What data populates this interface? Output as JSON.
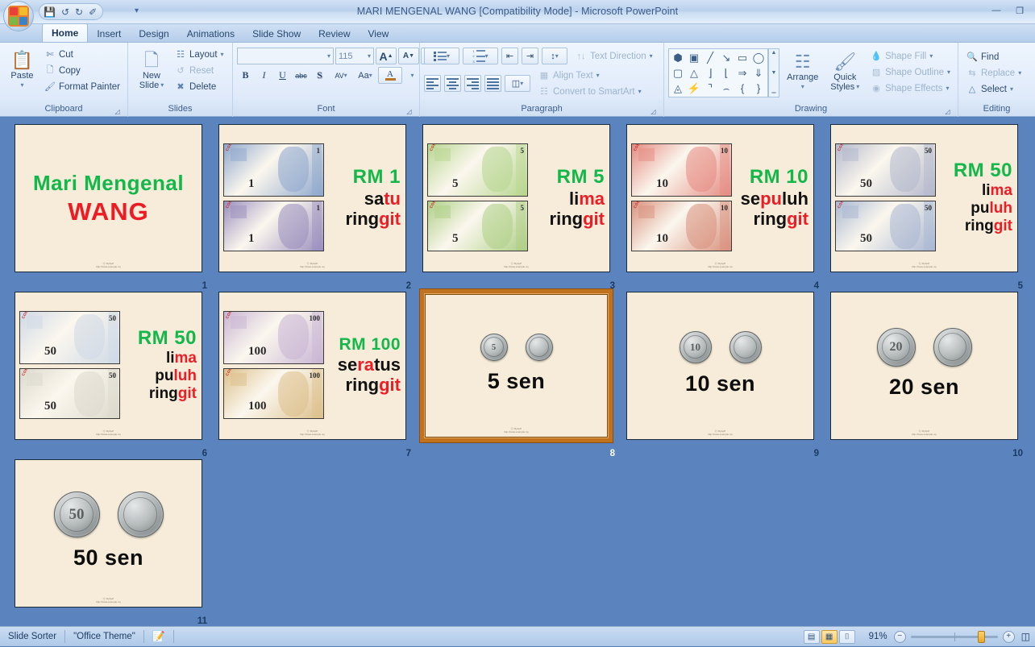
{
  "window": {
    "title": "MARI MENGENAL WANG [Compatibility Mode] - Microsoft PowerPoint",
    "minimize": "—",
    "restore": "❐",
    "qat": {
      "save": "save-icon",
      "undo": "↺",
      "redo": "↻",
      "start": "✐",
      "more": "▾"
    }
  },
  "tabs": [
    {
      "label": "Home",
      "active": true
    },
    {
      "label": "Insert",
      "active": false
    },
    {
      "label": "Design",
      "active": false
    },
    {
      "label": "Animations",
      "active": false
    },
    {
      "label": "Slide Show",
      "active": false
    },
    {
      "label": "Review",
      "active": false
    },
    {
      "label": "View",
      "active": false
    }
  ],
  "ribbon": {
    "clipboard": {
      "label": "Clipboard",
      "paste": "Paste",
      "cut": "Cut",
      "copy": "Copy",
      "format_painter": "Format Painter"
    },
    "slides": {
      "label": "Slides",
      "new_slide_1": "New",
      "new_slide_2": "Slide",
      "layout": "Layout",
      "reset": "Reset",
      "delete": "Delete"
    },
    "font": {
      "label": "Font",
      "font_name": "",
      "font_size": "115",
      "grow": "A",
      "shrink": "A",
      "clear_formatting": "clear-formatting-icon",
      "bold": "B",
      "italic": "I",
      "underline": "U",
      "strikethrough": "abc",
      "shadow": "S",
      "spacing": "AV",
      "change_case": "Aa",
      "font_color": "A"
    },
    "paragraph": {
      "label": "Paragraph",
      "text_direction": "Text Direction",
      "align_text": "Align Text",
      "convert_smartart": "Convert to SmartArt"
    },
    "drawing": {
      "label": "Drawing",
      "arrange": "Arrange",
      "quick_styles_1": "Quick",
      "quick_styles_2": "Styles",
      "shape_fill": "Shape Fill",
      "shape_outline": "Shape Outline",
      "shape_effects": "Shape Effects"
    },
    "editing": {
      "label": "Editing",
      "find": "Find",
      "replace": "Replace",
      "select": "Select"
    }
  },
  "slides": [
    {
      "num": "1",
      "kind": "title",
      "line1": "Mari Mengenal",
      "line2": "WANG",
      "selected": false
    },
    {
      "num": "2",
      "kind": "note",
      "rm": "RM 1",
      "denom": "1",
      "note_front_color": "#8fa8cd",
      "note_back_color": "#9a8fbe",
      "contoh": "CONTOH",
      "words": [
        [
          {
            "t": "sa",
            "c": "black"
          },
          {
            "t": "tu",
            "c": "red"
          }
        ],
        [
          {
            "t": "ring",
            "c": "black"
          },
          {
            "t": "git",
            "c": "red"
          }
        ]
      ],
      "selected": false
    },
    {
      "num": "3",
      "kind": "note",
      "rm": "RM 5",
      "denom": "5",
      "note_front_color": "#b7d68f",
      "note_back_color": "#aecf86",
      "contoh": "CONTOH",
      "words": [
        [
          {
            "t": "li",
            "c": "black"
          },
          {
            "t": "ma",
            "c": "red"
          }
        ],
        [
          {
            "t": "ring",
            "c": "black"
          },
          {
            "t": "git",
            "c": "red"
          }
        ]
      ],
      "selected": false
    },
    {
      "num": "4",
      "kind": "note",
      "rm": "RM 10",
      "denom": "10",
      "note_front_color": "#e58b82",
      "note_back_color": "#d9917e",
      "contoh": "CONTOH",
      "words": [
        [
          {
            "t": "se",
            "c": "black"
          },
          {
            "t": "pu",
            "c": "red"
          },
          {
            "t": "luh",
            "c": "black"
          }
        ],
        [
          {
            "t": "ring",
            "c": "black"
          },
          {
            "t": "git",
            "c": "red"
          }
        ]
      ],
      "selected": false
    },
    {
      "num": "5",
      "kind": "note",
      "rm": "RM 50",
      "denom": "50",
      "note_front_color": "#b3b8cc",
      "note_back_color": "#a9b7d2",
      "contoh": "CONTOH",
      "words": [
        [
          {
            "t": "li",
            "c": "black"
          },
          {
            "t": "ma",
            "c": "red"
          }
        ],
        [
          {
            "t": "pu",
            "c": "black"
          },
          {
            "t": "luh",
            "c": "red"
          }
        ],
        [
          {
            "t": "ring",
            "c": "black"
          },
          {
            "t": "git",
            "c": "red"
          }
        ]
      ],
      "selected": false
    },
    {
      "num": "6",
      "kind": "note",
      "rm": "RM 50",
      "denom": "50",
      "note_front_color": "#cfd9e6",
      "note_back_color": "#dcd9cd",
      "contoh": "CONTOH",
      "words": [
        [
          {
            "t": "li",
            "c": "black"
          },
          {
            "t": "ma",
            "c": "red"
          }
        ],
        [
          {
            "t": "pu",
            "c": "black"
          },
          {
            "t": "luh",
            "c": "red"
          }
        ],
        [
          {
            "t": "ring",
            "c": "black"
          },
          {
            "t": "git",
            "c": "red"
          }
        ]
      ],
      "selected": false
    },
    {
      "num": "7",
      "kind": "note",
      "rm": "RM 100",
      "denom": "100",
      "note_front_color": "#c9b5d4",
      "note_back_color": "#ddc08c",
      "contoh": "CONTOH",
      "words": [
        [
          {
            "t": "se",
            "c": "black"
          },
          {
            "t": "ra",
            "c": "red"
          },
          {
            "t": "tus",
            "c": "black"
          }
        ],
        [
          {
            "t": "ring",
            "c": "black"
          },
          {
            "t": "git",
            "c": "red"
          }
        ]
      ],
      "selected": false
    },
    {
      "num": "8",
      "kind": "coin",
      "label": "5 sen",
      "coin_value": "5",
      "coin_size": 34,
      "selected": true
    },
    {
      "num": "9",
      "kind": "coin",
      "label": "10 sen",
      "coin_value": "10",
      "coin_size": 40,
      "selected": false
    },
    {
      "num": "10",
      "kind": "coin",
      "label": "20 sen",
      "coin_value": "20",
      "coin_size": 48,
      "selected": false
    },
    {
      "num": "11",
      "kind": "coin",
      "label": "50 sen",
      "coin_value": "50",
      "coin_size": 57,
      "selected": false
    }
  ],
  "statusbar": {
    "view": "Slide Sorter",
    "theme": "\"Office Theme\"",
    "spellcheck": "spellcheck-icon",
    "views": [
      {
        "name": "normal-view",
        "glyph": "▤",
        "active": false
      },
      {
        "name": "slide-sorter-view",
        "glyph": "▦",
        "active": true
      },
      {
        "name": "slide-show-view",
        "glyph": "⌷",
        "active": false
      }
    ],
    "zoom": "91%",
    "zoom_out": "−",
    "zoom_in": "+"
  },
  "colors": {
    "accent_green": "#14b84a",
    "accent_red": "#ed1b24",
    "canvas_blue": "#5b84be",
    "selection_orange": "#c0721f",
    "slide_bg": "#f6ecd9"
  }
}
